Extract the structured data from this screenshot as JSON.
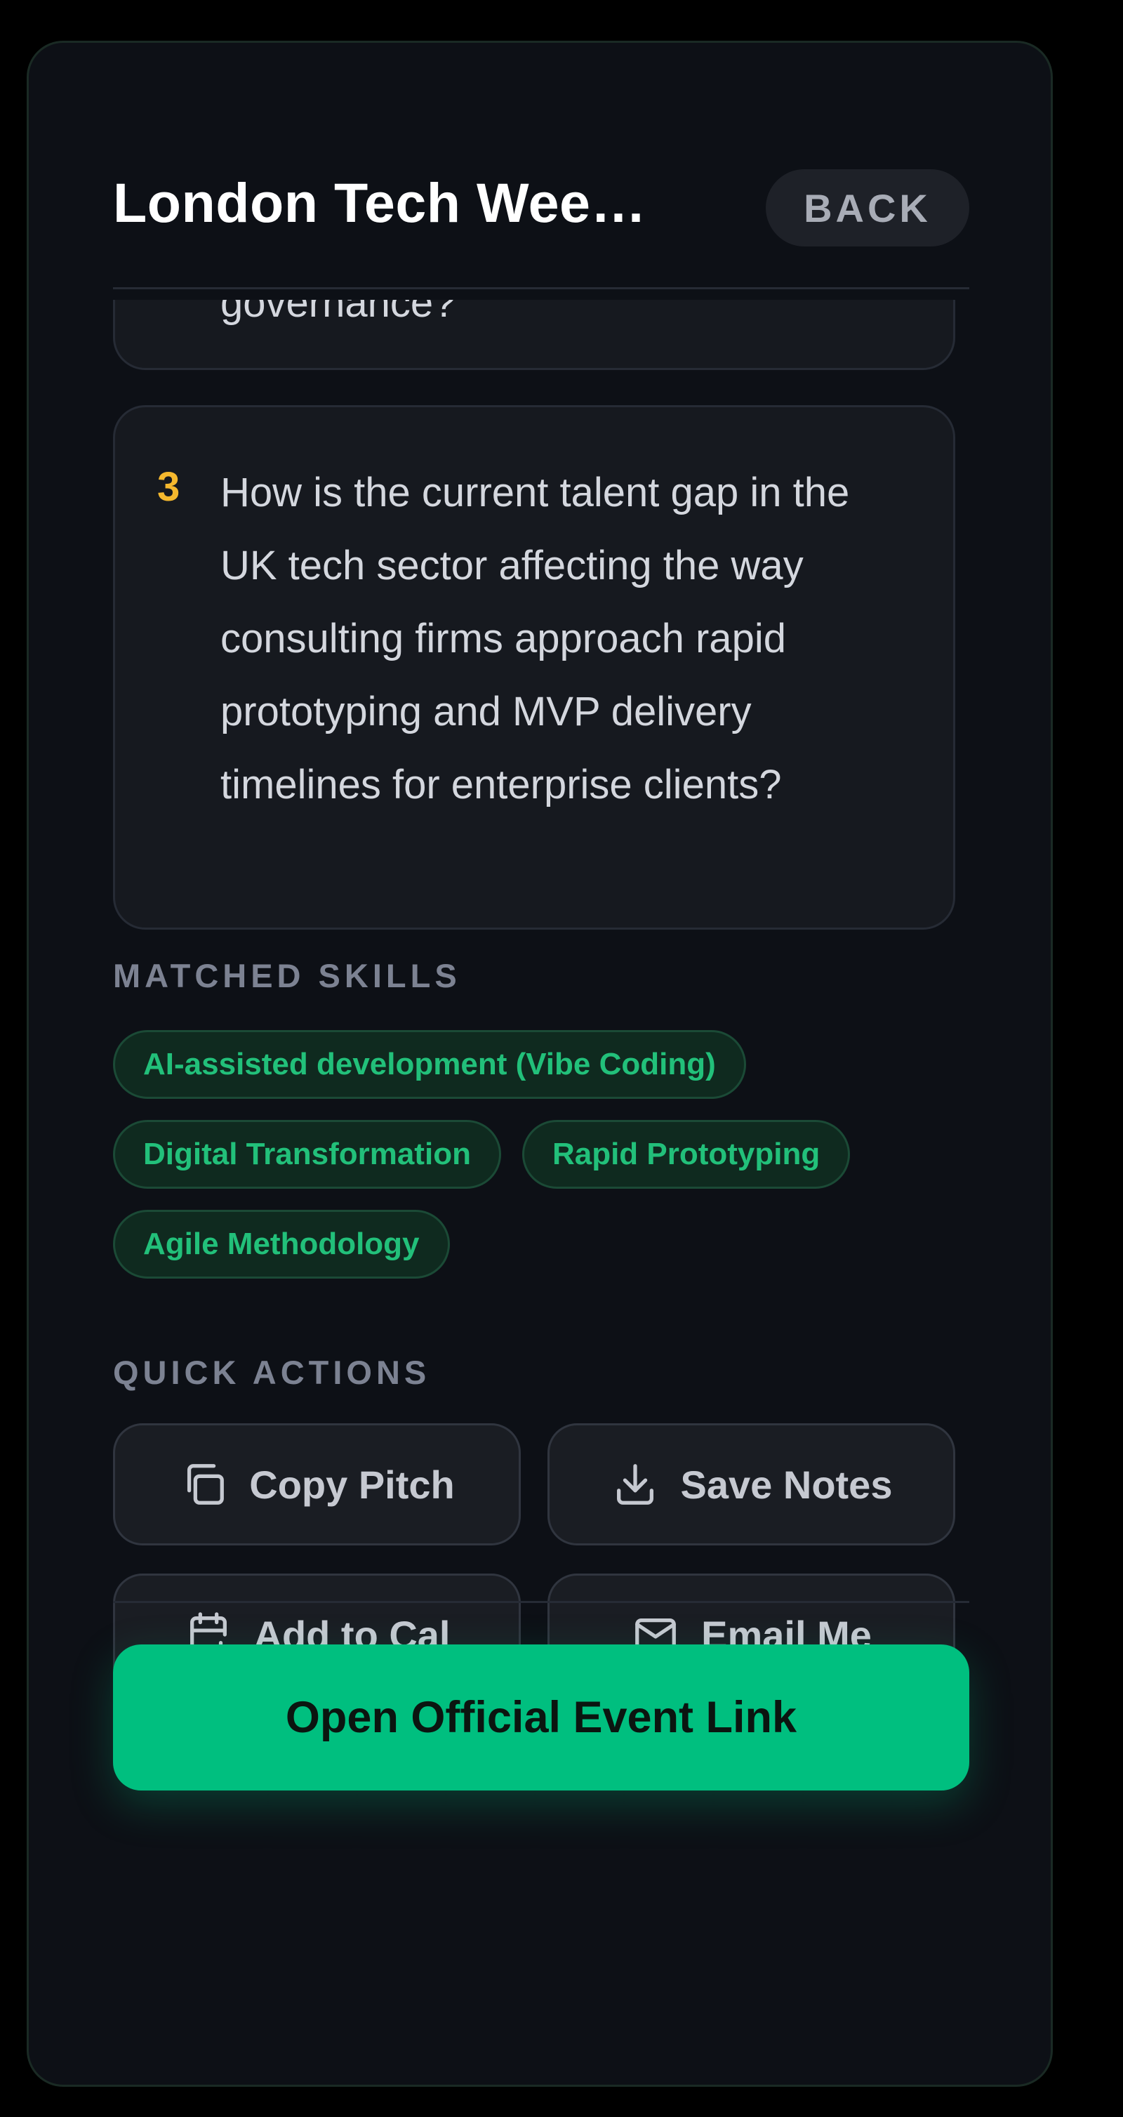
{
  "header": {
    "title": "London Tech Wee…",
    "back_label": "BACK"
  },
  "questions": [
    {
      "number": "",
      "text": "governance?"
    },
    {
      "number": "3",
      "text": "How is the current talent gap in the UK tech sector affecting the way consulting firms approach rapid prototyping and MVP delivery timelines for enterprise clients?"
    }
  ],
  "matched_skills": {
    "label": "MATCHED SKILLS",
    "items": [
      "AI-assisted development (Vibe Coding)",
      "Digital Transformation",
      "Rapid Prototyping",
      "Agile Methodology"
    ]
  },
  "quick_actions": {
    "label": "QUICK ACTIONS",
    "items": [
      {
        "label": "Copy Pitch",
        "icon": "copy-icon"
      },
      {
        "label": "Save Notes",
        "icon": "download-icon"
      },
      {
        "label": "Add to Cal",
        "icon": "calendar-add-icon"
      },
      {
        "label": "Email Me",
        "icon": "mail-icon"
      }
    ]
  },
  "cta": {
    "label": "Open Official Event Link"
  },
  "colors": {
    "accent": "#00bf7f",
    "question_number": "#f5b82e",
    "skill_text": "#22c07a",
    "background": "#0d1016"
  }
}
